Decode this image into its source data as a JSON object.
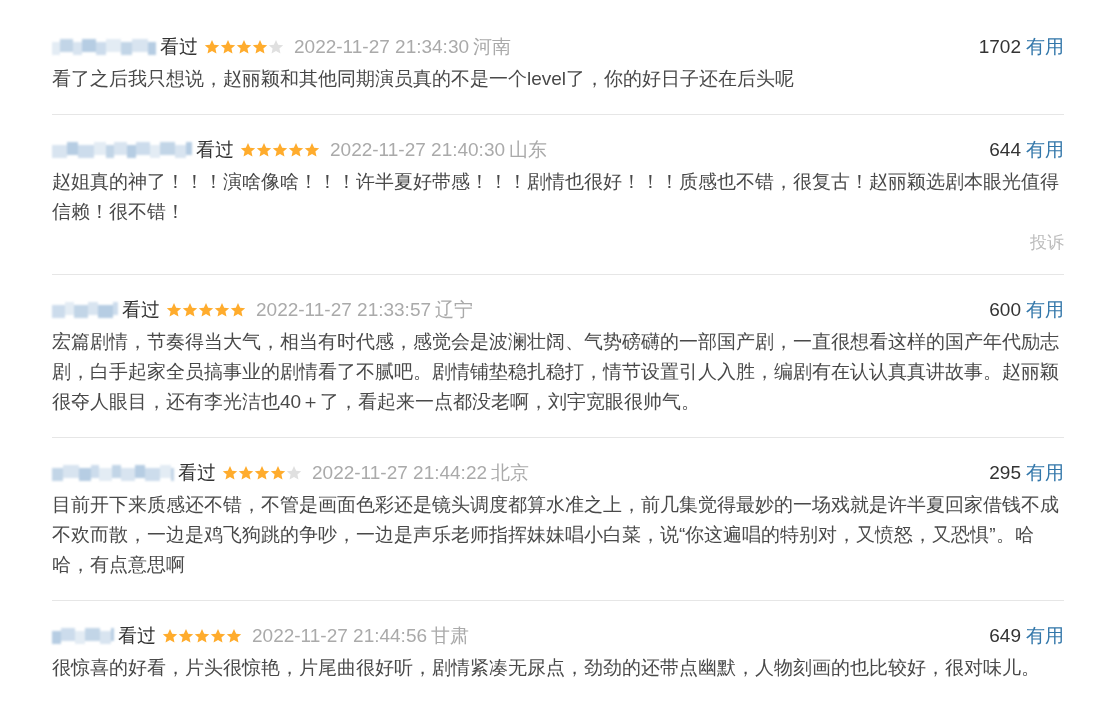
{
  "comments": [
    {
      "status": "看过",
      "stars": 4,
      "time": "2022-11-27 21:34:30",
      "location": "河南",
      "useful_count": "1702",
      "useful_label": "有用",
      "text": "看了之后我只想说，赵丽颖和其他同期演员真的不是一个level了，你的好日子还在后头呢"
    },
    {
      "status": "看过",
      "stars": 5,
      "time": "2022-11-27 21:40:30",
      "location": "山东",
      "useful_count": "644",
      "useful_label": "有用",
      "text": "赵姐真的神了！！！演啥像啥！！！许半夏好带感！！！剧情也很好！！！质感也不错，很复古！赵丽颖选剧本眼光值得信赖！很不错！",
      "report": "投诉"
    },
    {
      "status": "看过",
      "stars": 5,
      "time": "2022-11-27 21:33:57",
      "location": "辽宁",
      "useful_count": "600",
      "useful_label": "有用",
      "text": "宏篇剧情，节奏得当大气，相当有时代感，感觉会是波澜壮阔、气势磅礴的一部国产剧，一直很想看这样的国产年代励志剧，白手起家全员搞事业的剧情看了不腻吧。剧情铺垫稳扎稳打，情节设置引人入胜，编剧有在认认真真讲故事。赵丽颖很夺人眼目，还有李光洁也40＋了，看起来一点都没老啊，刘宇宽眼很帅气。"
    },
    {
      "status": "看过",
      "stars": 4,
      "time": "2022-11-27 21:44:22",
      "location": "北京",
      "useful_count": "295",
      "useful_label": "有用",
      "text": "目前开下来质感还不错，不管是画面色彩还是镜头调度都算水准之上，前几集觉得最妙的一场戏就是许半夏回家借钱不成不欢而散，一边是鸡飞狗跳的争吵，一边是声乐老师指挥妹妹唱小白菜，说“你这遍唱的特别对，又愤怒，又恐惧”。哈哈，有点意思啊"
    },
    {
      "status": "看过",
      "stars": 5,
      "time": "2022-11-27 21:44:56",
      "location": "甘肃",
      "useful_count": "649",
      "useful_label": "有用",
      "text": "很惊喜的好看，片头很惊艳，片尾曲很好听，剧情紧凑无尿点，劲劲的还带点幽默，人物刻画的也比较好，很对味儿。"
    }
  ]
}
